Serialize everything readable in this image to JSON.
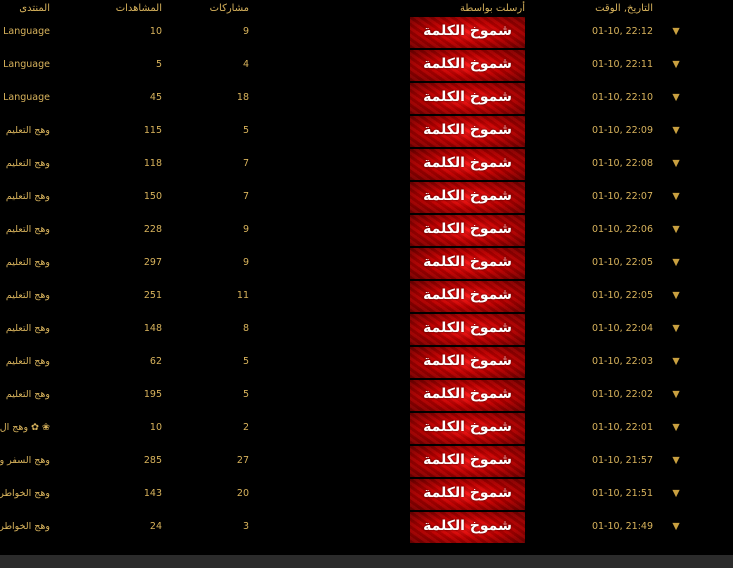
{
  "header": {
    "date_time": "التاريخ, الوقت",
    "sent_by": "أرسلت بواسطة",
    "posts": "مشاركات",
    "views": "المشاهدات",
    "forum": "المنتدى"
  },
  "rows": [
    {
      "date": "01-10, 22:12",
      "sender": "شموخ الكلمة",
      "posts": "9",
      "views": "10",
      "forum": "sh Language"
    },
    {
      "date": "01-10, 22:11",
      "sender": "شموخ الكلمة",
      "posts": "4",
      "views": "5",
      "forum": "sh Language"
    },
    {
      "date": "01-10, 22:10",
      "sender": "شموخ الكلمة",
      "posts": "18",
      "views": "45",
      "forum": "sh Language"
    },
    {
      "date": "01-10, 22:09",
      "sender": "شموخ الكلمة",
      "posts": "5",
      "views": "115",
      "forum": "وهج التعليم"
    },
    {
      "date": "01-10, 22:08",
      "sender": "شموخ الكلمة",
      "posts": "7",
      "views": "118",
      "forum": "وهج التعليم"
    },
    {
      "date": "01-10, 22:07",
      "sender": "شموخ الكلمة",
      "posts": "7",
      "views": "150",
      "forum": "وهج التعليم"
    },
    {
      "date": "01-10, 22:06",
      "sender": "شموخ الكلمة",
      "posts": "9",
      "views": "228",
      "forum": "وهج التعليم"
    },
    {
      "date": "01-10, 22:05",
      "sender": "شموخ الكلمة",
      "posts": "9",
      "views": "297",
      "forum": "وهج التعليم"
    },
    {
      "date": "01-10, 22:05",
      "sender": "شموخ الكلمة",
      "posts": "11",
      "views": "251",
      "forum": "وهج التعليم"
    },
    {
      "date": "01-10, 22:04",
      "sender": "شموخ الكلمة",
      "posts": "8",
      "views": "148",
      "forum": "وهج التعليم"
    },
    {
      "date": "01-10, 22:03",
      "sender": "شموخ الكلمة",
      "posts": "5",
      "views": "62",
      "forum": "وهج التعليم"
    },
    {
      "date": "01-10, 22:02",
      "sender": "شموخ الكلمة",
      "posts": "5",
      "views": "195",
      "forum": "وهج التعليم"
    },
    {
      "date": "01-10, 22:01",
      "sender": "شموخ الكلمة",
      "posts": "2",
      "views": "10",
      "forum": "❀ ✿ وهج ال"
    },
    {
      "date": "01-10, 21:57",
      "sender": "شموخ الكلمة",
      "posts": "27",
      "views": "285",
      "forum": "وهج السفر و"
    },
    {
      "date": "01-10, 21:51",
      "sender": "شموخ الكلمة",
      "posts": "20",
      "views": "143",
      "forum": "وهج الخواطر"
    },
    {
      "date": "01-10, 21:49",
      "sender": "شموخ الكلمة",
      "posts": "3",
      "views": "24",
      "forum": "وهج الخواطر"
    }
  ],
  "icons": {
    "row_arrow": "▼"
  },
  "colors": {
    "text": "#d8b35c",
    "background": "#000000",
    "sender_bg": "#c00000"
  }
}
